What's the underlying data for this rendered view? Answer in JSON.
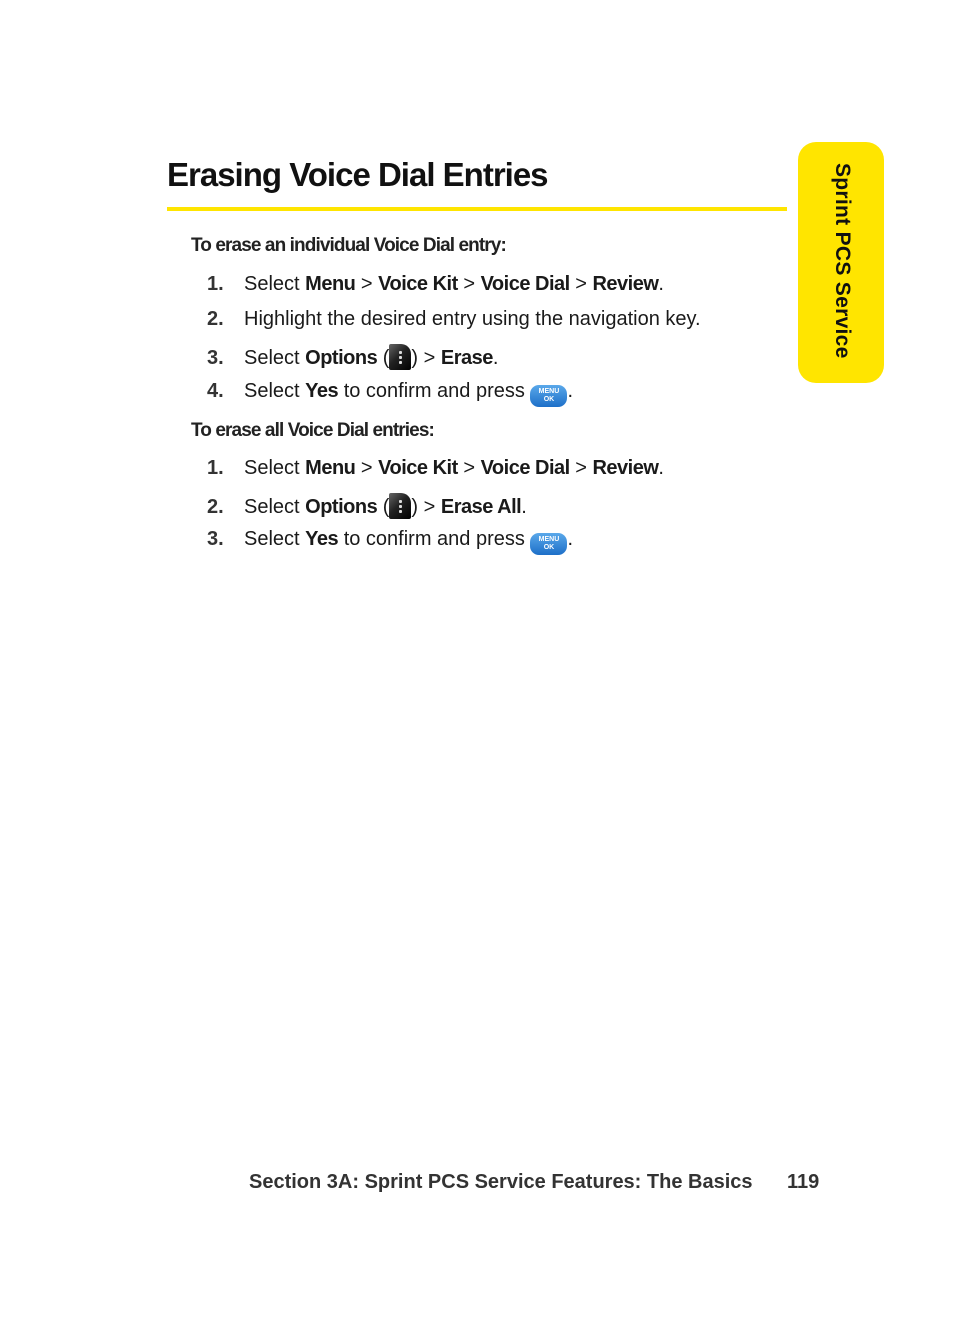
{
  "page": {
    "title": "Erasing Voice Dial Entries",
    "side_tab": "Sprint PCS Service",
    "colors": {
      "accent_yellow": "#ffe500",
      "ok_key_blue": "#2a7ed6"
    },
    "sections": [
      {
        "heading": "To erase an individual Voice Dial entry:",
        "steps": [
          {
            "num": "1.",
            "parts": [
              "Select ",
              "Menu",
              " > ",
              "Voice Kit",
              " > ",
              "Voice Dial",
              " > ",
              "Review",
              "."
            ]
          },
          {
            "num": "2.",
            "text": "Highlight the desired entry using the navigation key."
          },
          {
            "num": "3.",
            "pre": "Select ",
            "bold1": "Options",
            "open": " (",
            "icon": "options-softkey-icon",
            "close": ") > ",
            "bold2": "Erase",
            "end": "."
          },
          {
            "num": "4.",
            "pre": "Select ",
            "bold": "Yes",
            "post": " to confirm and press ",
            "icon": "menu-ok-key-icon",
            "end": "."
          }
        ]
      },
      {
        "heading": "To erase all Voice Dial entries:",
        "steps": [
          {
            "num": "1.",
            "parts": [
              "Select ",
              "Menu",
              " > ",
              "Voice Kit",
              " > ",
              "Voice Dial",
              " > ",
              "Review",
              "."
            ]
          },
          {
            "num": "2.",
            "pre": "Select ",
            "bold1": "Options",
            "open": " (",
            "icon": "options-softkey-icon",
            "close": ") > ",
            "bold2": "Erase All",
            "end": "."
          },
          {
            "num": "3.",
            "pre": "Select ",
            "bold": "Yes",
            "post": " to confirm and press ",
            "icon": "menu-ok-key-icon",
            "end": "."
          }
        ]
      }
    ],
    "ok_key_label_top": "MENU",
    "ok_key_label_bottom": "OK",
    "footer": {
      "section": "Section 3A: Sprint PCS Service Features: The Basics",
      "page_number": "119"
    }
  }
}
